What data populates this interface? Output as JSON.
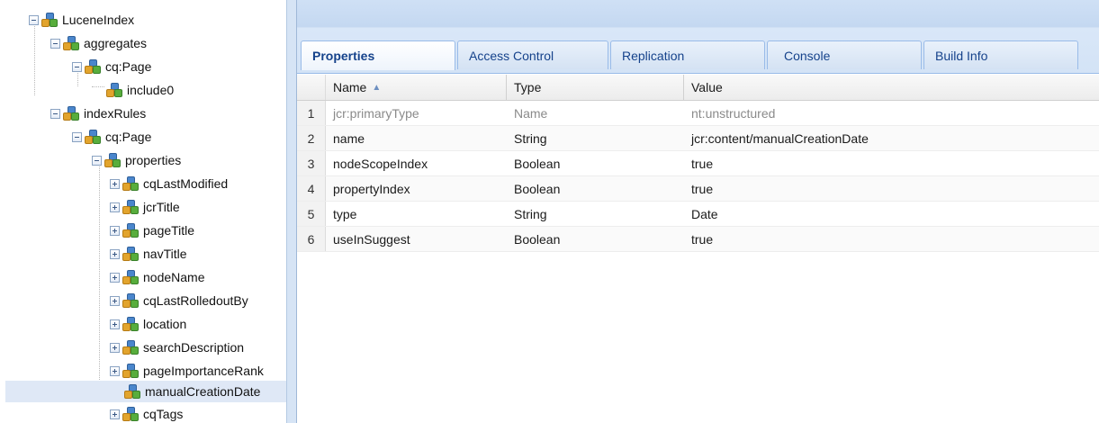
{
  "tree": {
    "nodes": [
      {
        "label": "LuceneIndex",
        "toggle": "minus"
      },
      {
        "label": "aggregates",
        "toggle": "minus"
      },
      {
        "label": "cq:Page",
        "toggle": "minus"
      },
      {
        "label": "include0",
        "toggle": "none"
      },
      {
        "label": "indexRules",
        "toggle": "minus"
      },
      {
        "label": "cq:Page",
        "toggle": "minus"
      },
      {
        "label": "properties",
        "toggle": "minus"
      },
      {
        "label": "cqLastModified",
        "toggle": "plus"
      },
      {
        "label": "jcrTitle",
        "toggle": "plus"
      },
      {
        "label": "pageTitle",
        "toggle": "plus"
      },
      {
        "label": "navTitle",
        "toggle": "plus"
      },
      {
        "label": "nodeName",
        "toggle": "plus"
      },
      {
        "label": "cqLastRolledoutBy",
        "toggle": "plus"
      },
      {
        "label": "location",
        "toggle": "plus"
      },
      {
        "label": "searchDescription",
        "toggle": "plus"
      },
      {
        "label": "pageImportanceRank",
        "toggle": "plus"
      },
      {
        "label": "manualCreationDate",
        "toggle": "none",
        "selected": true
      },
      {
        "label": "cqTags",
        "toggle": "plus"
      }
    ]
  },
  "tabs": [
    {
      "label": "Properties",
      "active": true
    },
    {
      "label": "Access Control"
    },
    {
      "label": "Replication"
    },
    {
      "label": "Console"
    },
    {
      "label": "Build Info"
    }
  ],
  "grid": {
    "columns": {
      "name": "Name",
      "type": "Type",
      "value": "Value",
      "sort_indicator": "▲"
    },
    "rows": [
      {
        "num": "1",
        "name": "jcr:primaryType",
        "type": "Name",
        "value": "nt:unstructured",
        "muted": true
      },
      {
        "num": "2",
        "name": "name",
        "type": "String",
        "value": "jcr:content/manualCreationDate"
      },
      {
        "num": "3",
        "name": "nodeScopeIndex",
        "type": "Boolean",
        "value": "true"
      },
      {
        "num": "4",
        "name": "propertyIndex",
        "type": "Boolean",
        "value": "true"
      },
      {
        "num": "5",
        "name": "type",
        "type": "String",
        "value": "Date"
      },
      {
        "num": "6",
        "name": "useInSuggest",
        "type": "Boolean",
        "value": "true"
      }
    ]
  },
  "colors": {
    "selected_row": "#dfe8f6",
    "tab_text": "#15428b",
    "header_band": "#c4d8f1"
  }
}
